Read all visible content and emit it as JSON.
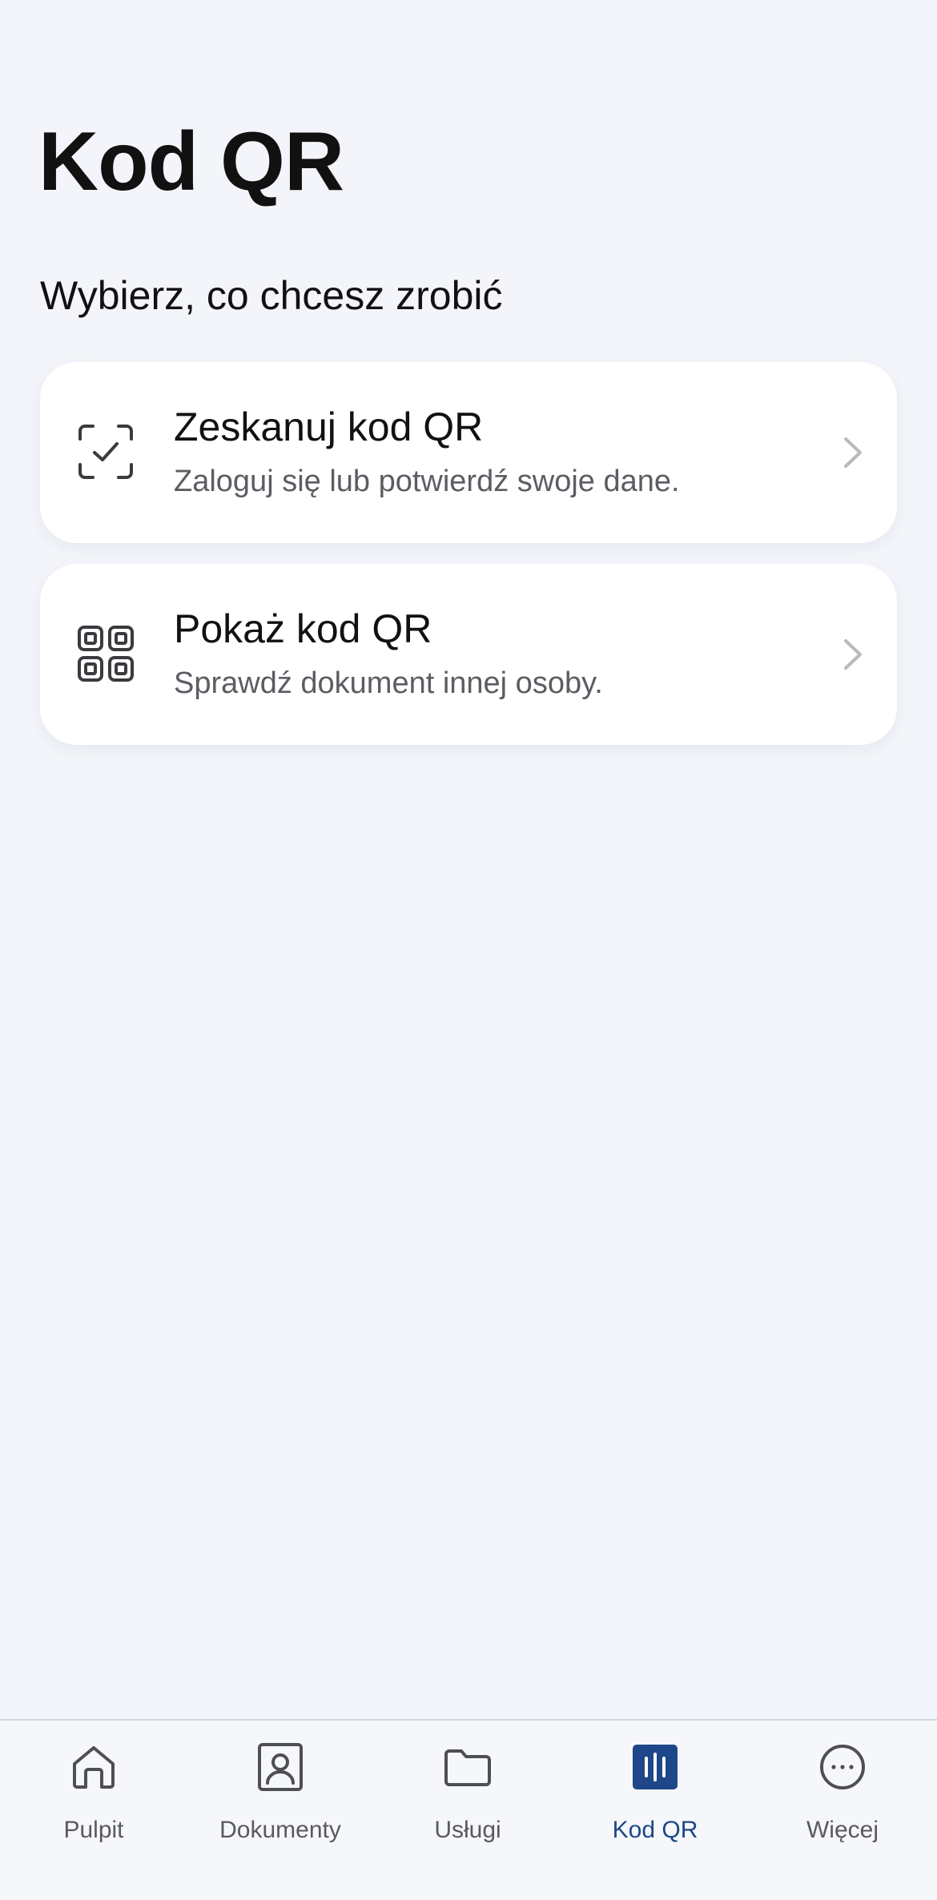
{
  "page": {
    "title": "Kod QR",
    "subtitle": "Wybierz, co chcesz zrobić"
  },
  "options": [
    {
      "title": "Zeskanuj kod QR",
      "description": "Zaloguj się lub potwierdź swoje dane.",
      "icon": "scan-check-icon"
    },
    {
      "title": "Pokaż kod QR",
      "description": "Sprawdź dokument innej osoby.",
      "icon": "qr-code-icon"
    }
  ],
  "tabbar": {
    "items": [
      {
        "label": "Pulpit",
        "icon": "home-icon",
        "active": false
      },
      {
        "label": "Dokumenty",
        "icon": "id-card-icon",
        "active": false
      },
      {
        "label": "Usługi",
        "icon": "folder-icon",
        "active": false
      },
      {
        "label": "Kod QR",
        "icon": "qr-tab-icon",
        "active": true
      },
      {
        "label": "Więcej",
        "icon": "more-icon",
        "active": false
      }
    ]
  },
  "colors": {
    "background": "#f3f5fa",
    "card": "#ffffff",
    "accent": "#1d4788",
    "inactive_tab": "#595a60",
    "secondary_text": "#5c5c63"
  }
}
